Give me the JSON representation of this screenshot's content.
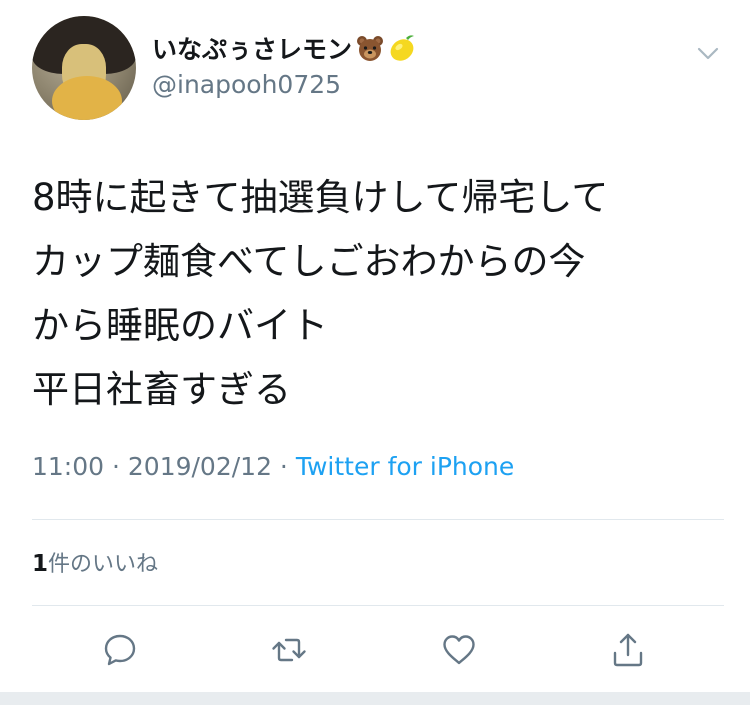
{
  "user": {
    "display_name": "いなぷぅさレモン",
    "handle": "@inapooh0725",
    "emoji": [
      "bear-face-emoji",
      "lemon-emoji"
    ]
  },
  "tweet": {
    "text": "8時に起きて抽選負けして帰宅して\nカップ麺食べてしごおわからの今\nから睡眠のバイト\n平日社畜すぎる",
    "time": "11:00",
    "separator": " · ",
    "date": "2019/02/12",
    "source": "Twitter for iPhone"
  },
  "engagement": {
    "likes_count": "1",
    "likes_label": "件のいいね"
  },
  "actions": [
    "reply-icon",
    "retweet-icon",
    "like-icon",
    "share-icon"
  ],
  "colors": {
    "text": "#14171a",
    "secondary": "#657786",
    "link": "#1da1f2",
    "divider": "#e1e8ed"
  }
}
